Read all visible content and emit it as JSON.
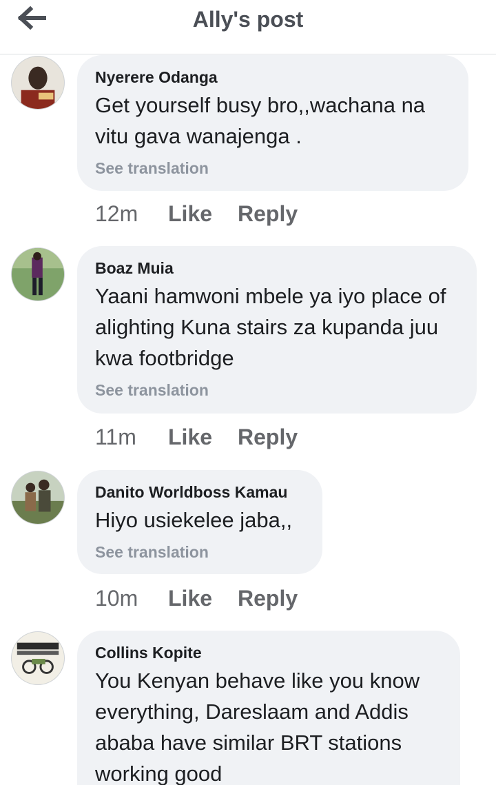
{
  "header": {
    "title": "Ally's post",
    "back_icon": "arrow-left-icon"
  },
  "comments": [
    {
      "author": "Nyerere Odanga",
      "text": "Get yourself busy bro,,wachana na vitu gava wanajenga .",
      "translate_label": "See translation",
      "time": "12m",
      "like_label": "Like",
      "reply_label": "Reply"
    },
    {
      "author": "Boaz Muia",
      "text": "Yaani hamwoni mbele ya iyo place of alighting Kuna stairs za kupanda juu kwa footbridge",
      "translate_label": "See translation",
      "time": "11m",
      "like_label": "Like",
      "reply_label": "Reply"
    },
    {
      "author": "Danito Worldboss Kamau",
      "text": "Hiyo usiekelee jaba,,",
      "translate_label": "See translation",
      "time": "10m",
      "like_label": "Like",
      "reply_label": "Reply"
    },
    {
      "author": "Collins Kopite",
      "text": "You Kenyan behave like you know everything, Dareslaam and Addis ababa have similar BRT stations working good"
    }
  ],
  "colors": {
    "bubble": "#f0f2f5",
    "title": "#4b4f56",
    "secondary_text": "#8d949e",
    "action_text": "#65676b"
  }
}
